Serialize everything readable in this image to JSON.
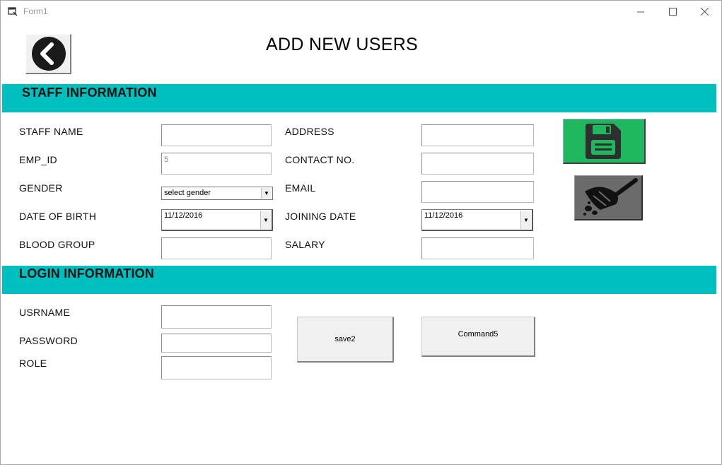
{
  "window": {
    "title": "Form1"
  },
  "header": {
    "title": "ADD NEW USERS"
  },
  "sections": {
    "staff": "STAFF INFORMATION",
    "login": "LOGIN INFORMATION"
  },
  "staff_fields": {
    "staff_name_label": "STAFF NAME",
    "emp_id_label": "EMP_ID",
    "emp_id_value": "5",
    "gender_label": "GENDER",
    "gender_value": "select gender",
    "dob_label": "DATE OF BIRTH",
    "dob_value": "11/12/2016",
    "blood_group_label": "BLOOD GROUP",
    "address_label": "ADDRESS",
    "contact_label": "CONTACT NO.",
    "email_label": "EMAIL",
    "joining_label": "JOINING DATE",
    "joining_value": "11/12/2016",
    "salary_label": "SALARY"
  },
  "login_fields": {
    "username_label": "USRNAME",
    "password_label": "PASSWORD",
    "role_label": "ROLE"
  },
  "buttons": {
    "save2": "save2",
    "command5": "Command5"
  },
  "colors": {
    "band": "#00bfbf",
    "save_button": "#1fb85e",
    "clear_button": "#6b6b6b"
  },
  "icons": {
    "back": "back-arrow-icon",
    "save": "floppy-disk-icon",
    "clear": "broom-icon"
  }
}
